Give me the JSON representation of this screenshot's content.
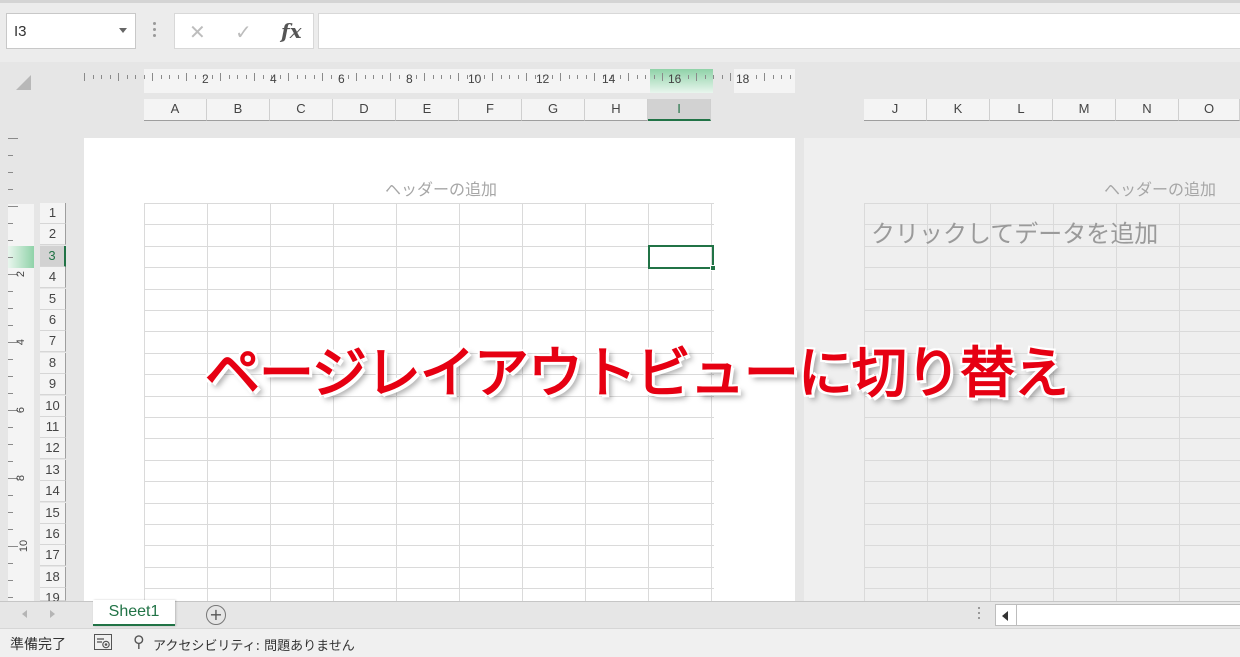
{
  "formula_bar": {
    "name_box": "I3",
    "cancel_icon": "✕",
    "enter_icon": "✓",
    "fx_label": "fx",
    "formula_value": ""
  },
  "ruler": {
    "numbers": [
      "2",
      "4",
      "6",
      "8",
      "10",
      "12",
      "14",
      "16",
      "18"
    ],
    "vertical_numbers": [
      "2",
      "4",
      "6",
      "8",
      "10"
    ]
  },
  "columns_page1": [
    "A",
    "B",
    "C",
    "D",
    "E",
    "F",
    "G",
    "H",
    "I"
  ],
  "columns_page2": [
    "J",
    "K",
    "L",
    "M",
    "N",
    "O"
  ],
  "rows": [
    "1",
    "2",
    "3",
    "4",
    "5",
    "6",
    "7",
    "8",
    "9",
    "10",
    "11",
    "12",
    "13",
    "14",
    "15",
    "16",
    "17",
    "18",
    "19"
  ],
  "selected": {
    "column": "I",
    "row": "3"
  },
  "page1": {
    "header_hint": "ヘッダーの追加"
  },
  "page2": {
    "header_hint": "ヘッダーの追加",
    "click_hint": "クリックしてデータを追加"
  },
  "overlay_caption": "ページレイアウトビューに切り替え",
  "sheet_tabs": {
    "active_tab": "Sheet1",
    "add_icon": "+"
  },
  "status_bar": {
    "ready": "準備完了",
    "accessibility": "アクセシビリティ: 問題ありません"
  },
  "colors": {
    "accent_green": "#217346",
    "overlay_red": "#e60012"
  }
}
